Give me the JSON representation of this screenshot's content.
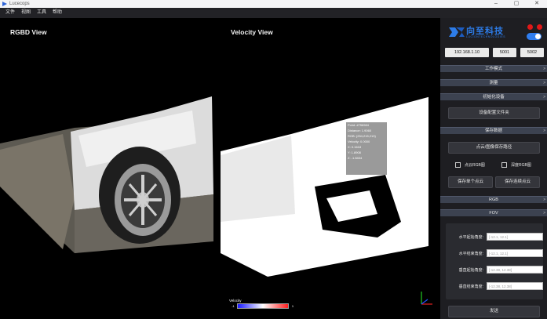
{
  "window": {
    "title": "Lucecops"
  },
  "menu": [
    "文件",
    "视图",
    "工具",
    "帮助"
  ],
  "views": {
    "rgbd_title": "RGBD View",
    "velocity_title": "Velocity View"
  },
  "probe": {
    "lines": [
      "Point: #756984",
      "Distance: 1.9060",
      "RGB: (254,215,213)",
      "Velocity: 0.0000",
      "X: 0.1618",
      "Y: 1.8908",
      "Z: -1.8404"
    ]
  },
  "colorbar": {
    "label": "Velocity",
    "min": "-1",
    "max": "1",
    "colors": [
      "#1a1aff",
      "#ffffff",
      "#ff2020"
    ]
  },
  "logo": {
    "cn": "向至科技",
    "en": "LUCIONTECHNOLOGIES",
    "color": "#2d7ce8"
  },
  "connection": {
    "ip": "192.168.1.10",
    "port1": "5001",
    "port2": "5002"
  },
  "sections": {
    "mode": "工作模式",
    "range": "测量",
    "init": "初始化设备",
    "save": "保存数据",
    "rgb": "RGB",
    "fov": "FOV"
  },
  "buttons": {
    "config": "设备配置文件夹",
    "pointcloud": "点云/图像保存路径",
    "save_single": "保存单个点云",
    "save_continuous": "保存连续点云",
    "send": "发送"
  },
  "checkboxes": {
    "cloud_rgb": "点云RGB图",
    "depth_rgb": "深度RGB图"
  },
  "fov": {
    "h_start_label": "水平起始角度:",
    "h_start_value": "[-12.1, 12.1]",
    "h_end_label": "水平结束角度:",
    "h_end_value": "[-12.1, 12.1]",
    "v_start_label": "垂直起始角度:",
    "v_start_value": "[-12.38, 12.38]",
    "v_end_label": "垂直结束角度:",
    "v_end_value": "[-12.38, 12.38]"
  },
  "colors": {
    "accent": "#2f7ef0",
    "status_dot": "#e01818",
    "section_bg": "#3c4250"
  }
}
